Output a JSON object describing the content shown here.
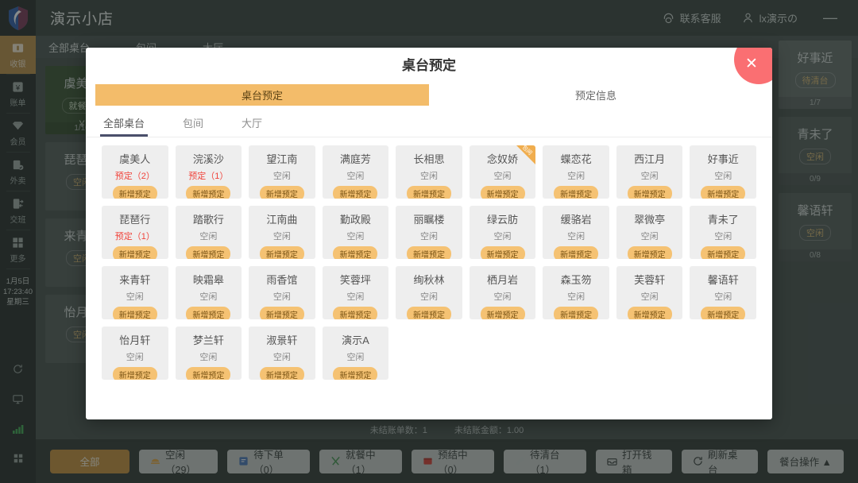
{
  "topbar": {
    "shop_name": "演示小店",
    "support_label": "联系客服",
    "support_icon": "headset-icon",
    "user_label": "lx演示の",
    "user_icon": "user-icon",
    "minimize_label": "—"
  },
  "sidebar": {
    "items": [
      {
        "label": "收银",
        "icon": "cashier-icon",
        "active": true
      },
      {
        "label": "账单",
        "icon": "bill-icon",
        "active": false
      },
      {
        "label": "会员",
        "icon": "member-diamond-icon",
        "active": false
      },
      {
        "label": "外卖",
        "icon": "takeout-icon",
        "active": false
      },
      {
        "label": "交班",
        "icon": "shift-handover-icon",
        "active": false
      },
      {
        "label": "更多",
        "icon": "grid-more-icon",
        "active": false
      }
    ],
    "clock": {
      "date": "1月5日",
      "time": "17:23:40",
      "weekday": "星期三"
    },
    "bottom_icons": [
      "refresh-icon",
      "monitor-icon",
      "signal-icon",
      "apps-grid-icon"
    ]
  },
  "background": {
    "tabs": [
      "全部桌台",
      "包间",
      "大厅"
    ],
    "right_label": "桌台预定",
    "right_label_icon": "table-grid-icon",
    "cards": [
      {
        "name": "虞美人",
        "status": "就餐中",
        "amount": "¥",
        "foot": "1/10",
        "occupied": true
      },
      {
        "name": "琵琶行",
        "status": "空闲",
        "foot": "",
        "occupied": false
      },
      {
        "name": "来青轩",
        "status": "空闲",
        "foot": "",
        "occupied": false
      },
      {
        "name": "怡月轩",
        "status": "空闲",
        "foot": "",
        "occupied": false
      }
    ],
    "peek_cards": [
      {
        "name": "好事近",
        "status": "待清台",
        "foot": "1/7",
        "highlight": true
      },
      {
        "name": "青未了",
        "status": "空闲",
        "foot": "0/9",
        "highlight": false
      },
      {
        "name": "馨语轩",
        "status": "空闲",
        "foot": "0/8",
        "highlight": false
      }
    ]
  },
  "status_strip": {
    "unsettled_count_label": "未结账单数：1",
    "unsettled_amount_label": "未结账金额：1.00"
  },
  "bottombar": {
    "buttons": [
      {
        "label": "全部",
        "icon": "",
        "primary": true
      },
      {
        "label": "空闲（29）",
        "icon": "free-table-icon",
        "primary": false
      },
      {
        "label": "待下单（0）",
        "icon": "pending-order-icon",
        "primary": false
      },
      {
        "label": "就餐中（1）",
        "icon": "dining-icon",
        "primary": false
      },
      {
        "label": "预结中（0）",
        "icon": "prebill-icon",
        "primary": false
      },
      {
        "label": "待清台（1）",
        "icon": "clean-table-icon",
        "primary": false
      },
      {
        "label": "打开钱箱",
        "icon": "cashbox-icon",
        "primary": false
      },
      {
        "label": "刷新桌台",
        "icon": "refresh-circle-icon",
        "primary": false
      },
      {
        "label": "餐台操作 ▲",
        "icon": "",
        "primary": false
      }
    ]
  },
  "modal": {
    "title": "桌台预定",
    "close_icon": "close-icon",
    "segments": [
      {
        "label": "桌台预定",
        "active": true
      },
      {
        "label": "预定信息",
        "active": false
      }
    ],
    "subtabs": [
      {
        "label": "全部桌台",
        "active": true
      },
      {
        "label": "包间",
        "active": false
      },
      {
        "label": "大厅",
        "active": false
      }
    ],
    "book_button_label": "新增预定",
    "tables": [
      {
        "name": "虞美人",
        "status": "预定（2）",
        "booked": true,
        "ribbon": ""
      },
      {
        "name": "浣溪沙",
        "status": "预定（1）",
        "booked": true,
        "ribbon": ""
      },
      {
        "name": "望江南",
        "status": "空闲",
        "booked": false,
        "ribbon": ""
      },
      {
        "name": "满庭芳",
        "status": "空闲",
        "booked": false,
        "ribbon": ""
      },
      {
        "name": "长相思",
        "status": "空闲",
        "booked": false,
        "ribbon": ""
      },
      {
        "name": "念奴娇",
        "status": "空闲",
        "booked": false,
        "ribbon": "包间"
      },
      {
        "name": "蝶恋花",
        "status": "空闲",
        "booked": false,
        "ribbon": ""
      },
      {
        "name": "西江月",
        "status": "空闲",
        "booked": false,
        "ribbon": ""
      },
      {
        "name": "好事近",
        "status": "空闲",
        "booked": false,
        "ribbon": ""
      },
      {
        "name": "琵琶行",
        "status": "预定（1）",
        "booked": true,
        "ribbon": ""
      },
      {
        "name": "踏歌行",
        "status": "空闲",
        "booked": false,
        "ribbon": ""
      },
      {
        "name": "江南曲",
        "status": "空闲",
        "booked": false,
        "ribbon": ""
      },
      {
        "name": "勤政殿",
        "status": "空闲",
        "booked": false,
        "ribbon": ""
      },
      {
        "name": "丽瞩楼",
        "status": "空闲",
        "booked": false,
        "ribbon": ""
      },
      {
        "name": "绿云肪",
        "status": "空闲",
        "booked": false,
        "ribbon": ""
      },
      {
        "name": "缓骆岩",
        "status": "空闲",
        "booked": false,
        "ribbon": ""
      },
      {
        "name": "翠微亭",
        "status": "空闲",
        "booked": false,
        "ribbon": ""
      },
      {
        "name": "青未了",
        "status": "空闲",
        "booked": false,
        "ribbon": ""
      },
      {
        "name": "来青轩",
        "status": "空闲",
        "booked": false,
        "ribbon": ""
      },
      {
        "name": "映霜皋",
        "status": "空闲",
        "booked": false,
        "ribbon": ""
      },
      {
        "name": "雨香馆",
        "status": "空闲",
        "booked": false,
        "ribbon": ""
      },
      {
        "name": "笑蓉坪",
        "status": "空闲",
        "booked": false,
        "ribbon": ""
      },
      {
        "name": "绚秋林",
        "status": "空闲",
        "booked": false,
        "ribbon": ""
      },
      {
        "name": "栖月岩",
        "status": "空闲",
        "booked": false,
        "ribbon": ""
      },
      {
        "name": "森玉笏",
        "status": "空闲",
        "booked": false,
        "ribbon": ""
      },
      {
        "name": "芙蓉轩",
        "status": "空闲",
        "booked": false,
        "ribbon": ""
      },
      {
        "name": "馨语轩",
        "status": "空闲",
        "booked": false,
        "ribbon": ""
      },
      {
        "name": "怡月轩",
        "status": "空闲",
        "booked": false,
        "ribbon": ""
      },
      {
        "name": "梦兰轩",
        "status": "空闲",
        "booked": false,
        "ribbon": ""
      },
      {
        "name": "淑景轩",
        "status": "空闲",
        "booked": false,
        "ribbon": ""
      },
      {
        "name": "演示A",
        "status": "空闲",
        "booked": false,
        "ribbon": ""
      }
    ]
  },
  "colors": {
    "accent_orange": "#f3bc6a",
    "brand_gold": "#c08a34",
    "close_pink": "#fa6f72",
    "booked_red": "#f0433b",
    "tab_underline": "#4a4f6b",
    "dark_panel": "#1b2320",
    "occupied_green": "#2f4a28"
  }
}
